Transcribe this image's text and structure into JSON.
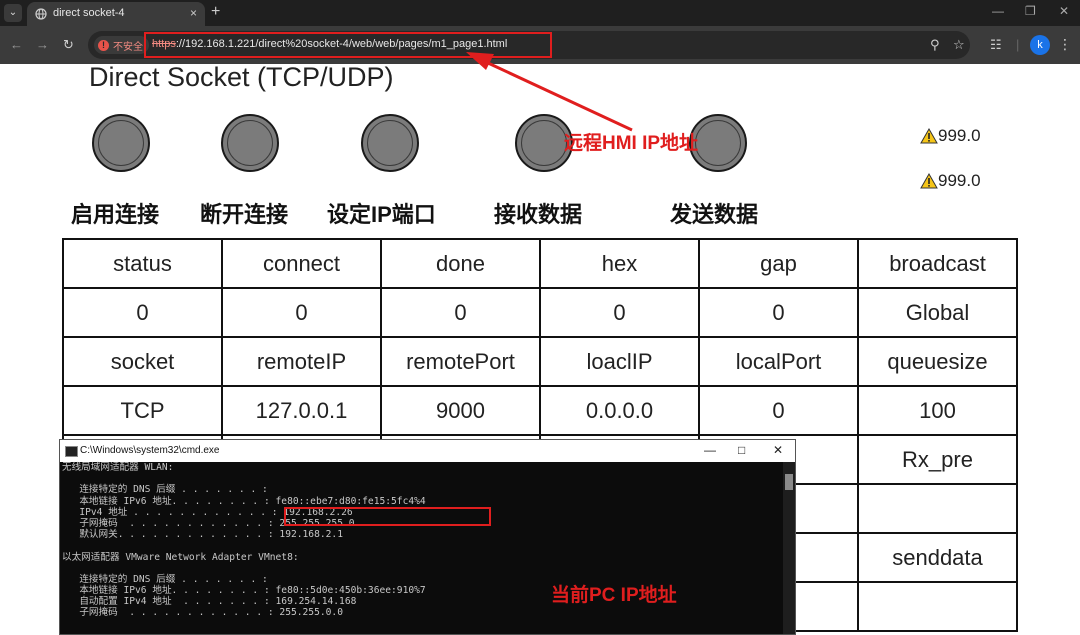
{
  "browser": {
    "tab_title": "direct socket-4",
    "tab_close": "×",
    "new_tab": "+",
    "security_label": "不安全",
    "url_scheme": "https",
    "url_rest": "://192.168.1.221/direct%20socket-4/web/web/pages/m1_page1.html",
    "profile_initial": "k",
    "colors": {
      "tabbar": "#1f1f1f",
      "toolbar": "#3b3b3b",
      "annotation_red": "#e01e1e"
    }
  },
  "page": {
    "title": "Direct Socket (TCP/UDP)",
    "warnings": [
      "999.0",
      "999.0"
    ],
    "button_labels": [
      "启用连接",
      "断开连接",
      "设定IP端口",
      "接收数据",
      "发送数据"
    ],
    "table": {
      "rows": [
        [
          "status",
          "connect",
          "done",
          "hex",
          "gap",
          "broadcast"
        ],
        [
          "0",
          "0",
          "0",
          "0",
          "0",
          "Global"
        ],
        [
          "socket",
          "remoteIP",
          "remotePort",
          "loaclIP",
          "localPort",
          "queuesize"
        ],
        [
          "TCP",
          "127.0.0.1",
          "9000",
          "0.0.0.0",
          "0",
          "100"
        ],
        [
          "",
          "",
          "",
          "",
          "ve",
          "Rx_pre"
        ],
        [
          "",
          "",
          "",
          "",
          "",
          ""
        ],
        [
          "",
          "",
          "",
          "",
          "ess",
          "senddata"
        ],
        [
          "",
          "",
          "",
          "",
          "",
          ""
        ]
      ]
    }
  },
  "annotations": {
    "remote_label": "远程HMI IP地址",
    "pc_label": "当前PC IP地址"
  },
  "cmd": {
    "title": "C:\\Windows\\system32\\cmd.exe",
    "lines": [
      "无线局域网适配器 WLAN:",
      "",
      "   连接特定的 DNS 后缀 . . . . . . . :",
      "   本地链接 IPv6 地址. . . . . . . . : fe80::ebe7:d80:fe15:5fc4%4",
      "   IPv4 地址 . . . . . . . . . . . . : 192.168.2.26",
      "   子网掩码  . . . . . . . . . . . . : 255.255.255.0",
      "   默认网关. . . . . . . . . . . . . : 192.168.2.1",
      "",
      "以太网适配器 VMware Network Adapter VMnet8:",
      "",
      "   连接特定的 DNS 后缀 . . . . . . . :",
      "   本地链接 IPv6 地址. . . . . . . . : fe80::5d0e:450b:36ee:910%7",
      "   自动配置 IPv4 地址  . . . . . . . : 169.254.14.168",
      "   子网掩码  . . . . . . . . . . . . : 255.255.0.0"
    ]
  }
}
